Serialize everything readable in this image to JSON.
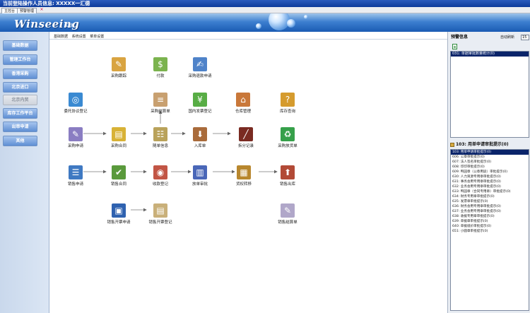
{
  "window": {
    "title": "当前登陆操作人员信息: XXXXX一汇德"
  },
  "tabs": [
    {
      "label": "主控台",
      "active": true
    },
    {
      "label": "预警管理",
      "active": false
    }
  ],
  "banner": {
    "logo": "Winseeing",
    "logo_sub": "汇德"
  },
  "leftnav": [
    {
      "label": "基础数据",
      "enabled": true
    },
    {
      "label": "管理工作台",
      "enabled": true
    },
    {
      "label": "香港采购",
      "enabled": true
    },
    {
      "label": "北京进口",
      "enabled": true
    },
    {
      "label": "北京内贸",
      "enabled": false
    },
    {
      "label": "库存工作平台",
      "enabled": true
    },
    {
      "label": "出审申请",
      "enabled": true
    },
    {
      "label": "其他",
      "enabled": true
    }
  ],
  "breadcrumb": [
    "基础数据",
    "系统设置",
    "菜单设置"
  ],
  "flow": {
    "nodes": {
      "purchase_track": {
        "label": "采购跟踪",
        "icon": "purchase-track-icon",
        "color": "#d9a441"
      },
      "payment": {
        "label": "付款",
        "icon": "payment-icon",
        "color": "#7bb34e"
      },
      "purchase_refund_apply": {
        "label": "采购退款申请",
        "icon": "refund-apply-icon",
        "color": "#4f83c9"
      },
      "entrust_register": {
        "label": "委托协议登记",
        "icon": "globe-doc-icon",
        "color": "#3a8ad2"
      },
      "purchase_settlement": {
        "label": "采购结算单",
        "icon": "settlement-icon",
        "color": "#c8a070"
      },
      "domestic_invoice_register": {
        "label": "国内发票登记",
        "icon": "money-icon",
        "color": "#58ad45"
      },
      "warehouse_mgmt": {
        "label": "仓库管理",
        "icon": "warehouse-icon",
        "color": "#c9783a"
      },
      "stock_query": {
        "label": "库存查询",
        "icon": "stock-query-icon",
        "color": "#d59b2e"
      },
      "purchase_apply": {
        "label": "采购申请",
        "icon": "purchase-apply-icon",
        "color": "#8a7dc2"
      },
      "purchase_contract": {
        "label": "采购合同",
        "icon": "contract-icon",
        "color": "#d8b236"
      },
      "follow_info": {
        "label": "随单信息",
        "icon": "follow-info-icon",
        "color": "#b9a25a"
      },
      "stock_in": {
        "label": "入库单",
        "icon": "stock-in-icon",
        "color": "#a96b3b"
      },
      "split_record": {
        "label": "拆分记录",
        "icon": "split-record-icon",
        "color": "#7a2b22"
      },
      "purchase_return": {
        "label": "采购放货单",
        "icon": "recycle-icon",
        "color": "#36a04a"
      },
      "sales_apply": {
        "label": "销售申请",
        "icon": "sales-apply-icon",
        "color": "#3f79c2"
      },
      "sales_contract": {
        "label": "销售合同",
        "icon": "sales-contract-icon",
        "color": "#5a9a3c"
      },
      "receipt_register": {
        "label": "收款登记",
        "icon": "receipt-icon",
        "color": "#c25545"
      },
      "release_approval": {
        "label": "放单审批",
        "icon": "binders-icon",
        "color": "#4a67b8"
      },
      "goods_transfer": {
        "label": "货权转移",
        "icon": "goods-transfer-icon",
        "color": "#b8872e"
      },
      "sales_outbound": {
        "label": "销售出库",
        "icon": "sales-outbound-icon",
        "color": "#b24a36"
      },
      "sales_invoice_apply": {
        "label": "销售开票申请",
        "icon": "book-icon",
        "color": "#2f62b0"
      },
      "sales_invoice_register": {
        "label": "销售开票登记",
        "icon": "invoice-register-icon",
        "color": "#c9b07a"
      },
      "sales_settlement": {
        "label": "销售结算单",
        "icon": "sales-settlement-icon",
        "color": "#b0a7c9"
      }
    }
  },
  "right_panel": {
    "title": "预警信息",
    "refresh_label": "自动刷新",
    "refresh_value": "15",
    "top_list": [
      "031: 单据审批数量统计(0)"
    ],
    "group_title": "103: 用单申请审批提示(0)",
    "list": [
      "103: 用单申请审批提示(0)",
      "606: 公章审批提示(0)",
      "607: 法人签名审批提示(0)",
      "608: 印印审批提示(0)",
      "609: 鸭园章（公章用途）审批提示(0)",
      "630: 人力资源专用章审批提示(0)",
      "631: 事务会用专用章审批提示(0)",
      "632: 业务会用专用章审批提示(0)",
      "633: 鸭园章（合同专用章）审批提示(0)",
      "634: 财务专用章审批提示(0)",
      "635: 发票章审批提示(0)",
      "636: 财务会用专用章审批提示(0)",
      "637: 业务会用专用章审批提示(0)",
      "638: 收据专用章审批提示(0)",
      "639: 单据章审批提示(0)",
      "640: 单据纸价审批提示(0)",
      "651: 小圆章审批提示(0)"
    ]
  }
}
